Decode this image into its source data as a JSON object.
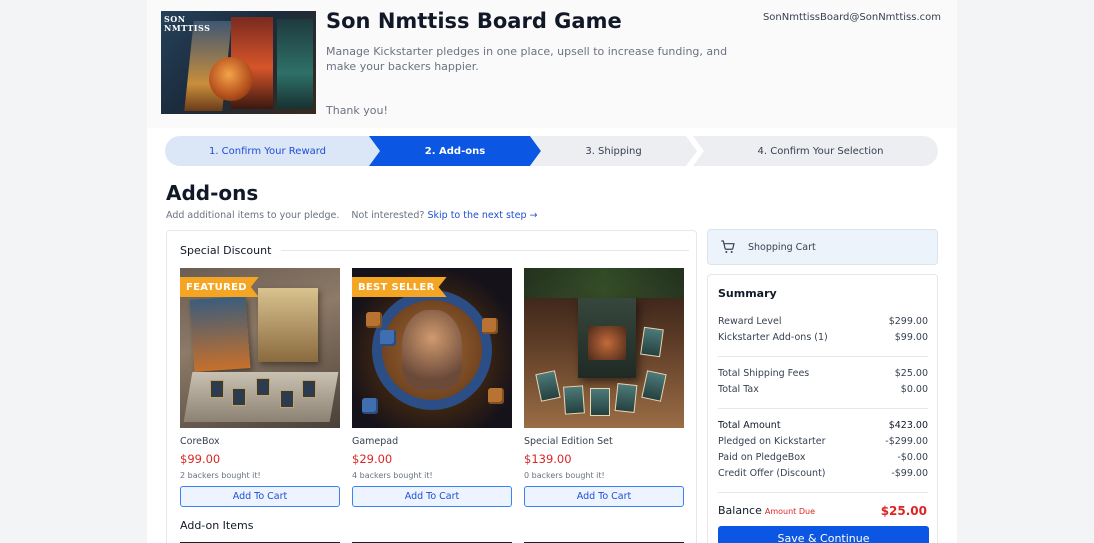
{
  "header": {
    "cover_logo": "SON NMTTISS",
    "title": "Son Nmttiss Board Game",
    "subtitle": "Manage Kickstarter pledges in one place, upsell to increase funding, and make your backers happier.",
    "thanks": "Thank you!",
    "email": "SonNmttissBoard@SonNmttiss.com"
  },
  "steps": [
    {
      "label": "1. Confirm Your Reward",
      "state": "completed"
    },
    {
      "label": "2. Add-ons",
      "state": "active"
    },
    {
      "label": "3. Shipping",
      "state": "upcoming"
    },
    {
      "label": "4. Confirm Your Selection",
      "state": "upcoming"
    }
  ],
  "section": {
    "title": "Add-ons",
    "description": "Add additional items to your pledge.",
    "not_interested": "Not interested?",
    "skip_link": "Skip to the next step →"
  },
  "groups": {
    "special_discount": "Special Discount",
    "addon_items": "Add-on Items"
  },
  "products": [
    {
      "name": "CoreBox",
      "price": "$99.00",
      "backers": "2 backers bought it!",
      "ribbon": "FEATURED",
      "button": "Add To Cart"
    },
    {
      "name": "Gamepad",
      "price": "$29.00",
      "backers": "4 backers bought it!",
      "ribbon": "BEST SELLER",
      "button": "Add To Cart"
    },
    {
      "name": "Special Edition Set",
      "price": "$139.00",
      "backers": "0 backers bought it!",
      "ribbon": "",
      "button": "Add To Cart"
    }
  ],
  "cart": {
    "label": "Shopping Cart",
    "icon": "shopping-cart-icon"
  },
  "summary": {
    "title": "Summary",
    "reward_level": {
      "label": "Reward Level",
      "value": "$299.00"
    },
    "addons": {
      "label": "Kickstarter Add-ons (1)",
      "value": "$99.00"
    },
    "shipping": {
      "label": "Total Shipping Fees",
      "value": "$25.00"
    },
    "tax": {
      "label": "Total Tax",
      "value": "$0.00"
    },
    "total": {
      "label": "Total Amount",
      "value": "$423.00"
    },
    "pledged": {
      "label": "Pledged on Kickstarter",
      "value": "-$299.00"
    },
    "paid": {
      "label": "Paid on PledgeBox",
      "value": "-$0.00"
    },
    "credit": {
      "label": "Credit Offer (Discount)",
      "value": "-$99.00"
    },
    "balance_label": "Balance",
    "amount_due": "Amount Due",
    "balance_value": "$25.00",
    "save_button": "Save & Continue"
  },
  "colors": {
    "accent": "#0b57e4",
    "price": "#dc2626",
    "ribbon": "#f5a524"
  }
}
